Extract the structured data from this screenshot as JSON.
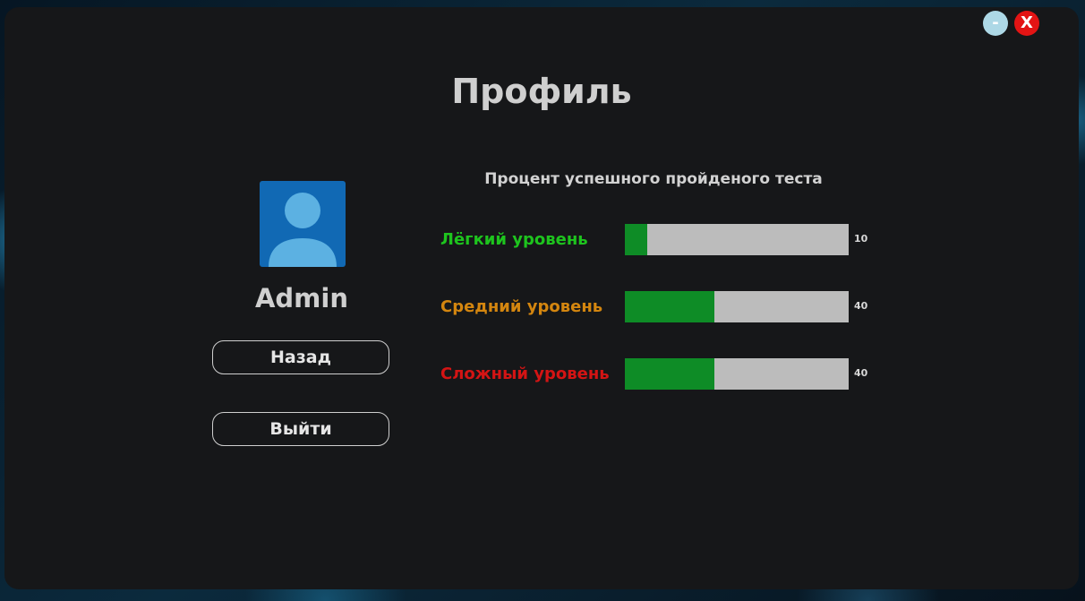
{
  "window": {
    "minimize_label": "-",
    "close_label": "X"
  },
  "page": {
    "title": "Профиль"
  },
  "user": {
    "name": "Admin",
    "avatar_icon": "user-avatar-icon"
  },
  "buttons": {
    "back_label": "Назад",
    "logout_label": "Выйти"
  },
  "stats": {
    "heading": "Процент успешного пройденого теста",
    "max": 100,
    "levels": [
      {
        "label": "Лёгкий уровень",
        "value": 10,
        "value_text": "10",
        "color": "#1ec41e"
      },
      {
        "label": "Средний уровень",
        "value": 40,
        "value_text": "40",
        "color": "#d4860f"
      },
      {
        "label": "Сложный уровень",
        "value": 40,
        "value_text": "40",
        "color": "#d41414"
      }
    ]
  },
  "colors": {
    "bar_fill": "#0e8c26",
    "bar_track": "#bcbcbc",
    "window_bg": "#161719"
  }
}
